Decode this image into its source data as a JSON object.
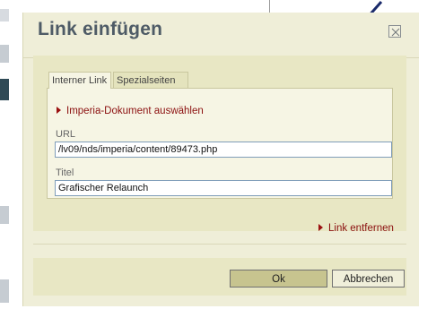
{
  "dialog": {
    "title": "Link einfügen",
    "close_icon": "close-icon"
  },
  "tabs": [
    {
      "label": "Interner Link",
      "active": true
    },
    {
      "label": "Spezialseiten",
      "active": false
    }
  ],
  "internal_link": {
    "select_document_label": "Imperia-Dokument auswählen",
    "url_label": "URL",
    "url_value": "/lv09/nds/imperia/content/89473.php",
    "title_label": "Titel",
    "title_value": "Grafischer Relaunch",
    "remove_link_label": "Link entfernen"
  },
  "footer": {
    "ok_label": "Ok",
    "cancel_label": "Abbrechen"
  },
  "colors": {
    "dialog_bg": "#efeed8",
    "panel_bg": "#e8e7c4",
    "accent_red": "#8b0f0f",
    "title_color": "#4e5b66"
  }
}
